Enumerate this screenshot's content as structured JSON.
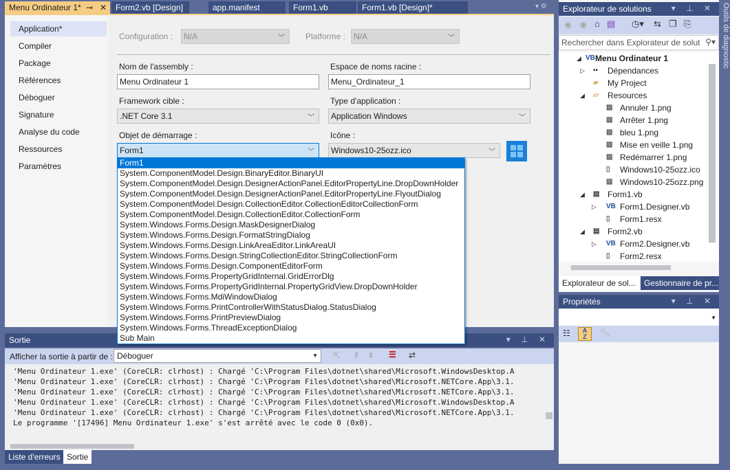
{
  "tabs": [
    {
      "label": "Menu Ordinateur 1*",
      "active": true
    },
    {
      "label": "Form2.vb [Design]"
    },
    {
      "label": "app.manifest"
    },
    {
      "label": "Form1.vb"
    },
    {
      "label": "Form1.vb [Design]*"
    }
  ],
  "nav": {
    "items": [
      "Application*",
      "Compiler",
      "Package",
      "Références",
      "Déboguer",
      "Signature",
      "Analyse du code",
      "Ressources",
      "Paramètres"
    ],
    "active": 0
  },
  "form": {
    "configuration_label": "Configuration :",
    "configuration_value": "N/A",
    "platform_label": "Platforme :",
    "platform_value": "N/A",
    "assembly_label": "Nom de l'assembly :",
    "assembly_value": "Menu Ordinateur 1",
    "namespace_label": "Espace de noms racine :",
    "namespace_value": "Menu_Ordinateur_1",
    "framework_label": "Framework cible :",
    "framework_value": ".NET Core 3.1",
    "apptype_label": "Type d'application :",
    "apptype_value": "Application Windows",
    "startup_label": "Objet de démarrage :",
    "startup_value": "Form1",
    "icon_label": "Icône :",
    "icon_value": "Windows10-25ozz.ico"
  },
  "startup_options": [
    "Form1",
    "System.ComponentModel.Design.BinaryEditor.BinaryUI",
    "System.ComponentModel.Design.DesignerActionPanel.EditorPropertyLine.DropDownHolder",
    "System.ComponentModel.Design.DesignerActionPanel.EditorPropertyLine.FlyoutDialog",
    "System.ComponentModel.Design.CollectionEditor.CollectionEditorCollectionForm",
    "System.ComponentModel.Design.CollectionEditor.CollectionForm",
    "System.Windows.Forms.Design.MaskDesignerDialog",
    "System.Windows.Forms.Design.FormatStringDialog",
    "System.Windows.Forms.Design.LinkAreaEditor.LinkAreaUI",
    "System.Windows.Forms.Design.StringCollectionEditor.StringCollectionForm",
    "System.Windows.Forms.Design.ComponentEditorForm",
    "System.Windows.Forms.PropertyGridInternal.GridErrorDlg",
    "System.Windows.Forms.PropertyGridInternal.PropertyGridView.DropDownHolder",
    "System.Windows.Forms.MdiWindowDialog",
    "System.Windows.Forms.PrintControllerWithStatusDialog.StatusDialog",
    "System.Windows.Forms.PrintPreviewDialog",
    "System.Windows.Forms.ThreadExceptionDialog",
    "Sub Main"
  ],
  "output": {
    "title": "Sortie",
    "source_label": "Afficher la sortie à partir de :",
    "source_value": "Déboguer",
    "lines": [
      "'Menu Ordinateur 1.exe' (CoreCLR: clrhost) : Chargé 'C:\\Program Files\\dotnet\\shared\\Microsoft.WindowsDesktop.A",
      "'Menu Ordinateur 1.exe' (CoreCLR: clrhost) : Chargé 'C:\\Program Files\\dotnet\\shared\\Microsoft.NETCore.App\\3.1.",
      "'Menu Ordinateur 1.exe' (CoreCLR: clrhost) : Chargé 'C:\\Program Files\\dotnet\\shared\\Microsoft.NETCore.App\\3.1.",
      "'Menu Ordinateur 1.exe' (CoreCLR: clrhost) : Chargé 'C:\\Program Files\\dotnet\\shared\\Microsoft.WindowsDesktop.A",
      "'Menu Ordinateur 1.exe' (CoreCLR: clrhost) : Chargé 'C:\\Program Files\\dotnet\\shared\\Microsoft.NETCore.App\\3.1.",
      "Le programme '[17496] Menu Ordinateur 1.exe' s'est arrêté avec le code 0 (0x0)."
    ]
  },
  "bottom_tabs": [
    "Liste d'erreurs",
    "Sortie"
  ],
  "solution": {
    "title": "Explorateur de solutions",
    "search_placeholder": "Rechercher dans Explorateur de solut",
    "tree": [
      {
        "label": "Menu Ordinateur 1",
        "level": 0,
        "exp": "open",
        "icon": "vb-project",
        "bold": true
      },
      {
        "label": "Dépendances",
        "level": 1,
        "exp": "closed",
        "icon": "dependencies"
      },
      {
        "label": "My Project",
        "level": 1,
        "exp": "",
        "icon": "folder-wrench"
      },
      {
        "label": "Resources",
        "level": 1,
        "exp": "open",
        "icon": "folder-open"
      },
      {
        "label": "Annuler 1.png",
        "level": 2,
        "exp": "",
        "icon": "image"
      },
      {
        "label": "Arrêter 1.png",
        "level": 2,
        "exp": "",
        "icon": "image"
      },
      {
        "label": "bleu 1.png",
        "level": 2,
        "exp": "",
        "icon": "image"
      },
      {
        "label": "Mise en veille 1.png",
        "level": 2,
        "exp": "",
        "icon": "image"
      },
      {
        "label": "Redémarrer 1.png",
        "level": 2,
        "exp": "",
        "icon": "image"
      },
      {
        "label": "Windows10-25ozz.ico",
        "level": 2,
        "exp": "",
        "icon": "icon-file"
      },
      {
        "label": "Windows10-25ozz.png",
        "level": 2,
        "exp": "",
        "icon": "image"
      },
      {
        "label": "Form1.vb",
        "level": 1,
        "exp": "open",
        "icon": "form"
      },
      {
        "label": "Form1.Designer.vb",
        "level": 2,
        "exp": "closed",
        "icon": "vb"
      },
      {
        "label": "Form1.resx",
        "level": 2,
        "exp": "",
        "icon": "file"
      },
      {
        "label": "Form2.vb",
        "level": 1,
        "exp": "open",
        "icon": "form"
      },
      {
        "label": "Form2.Designer.vb",
        "level": 2,
        "exp": "closed",
        "icon": "vb"
      },
      {
        "label": "Form2.resx",
        "level": 2,
        "exp": "",
        "icon": "file"
      }
    ],
    "tabs": [
      "Explorateur de sol...",
      "Gestionnaire de pr..."
    ]
  },
  "properties": {
    "title": "Propriétés"
  },
  "side_strip": "Outils de diagnostic",
  "colors": {
    "active_tab": "#f5cc84",
    "accent": "#0078d7",
    "panel_header": "#3b4f81",
    "background": "#5d6b99"
  }
}
